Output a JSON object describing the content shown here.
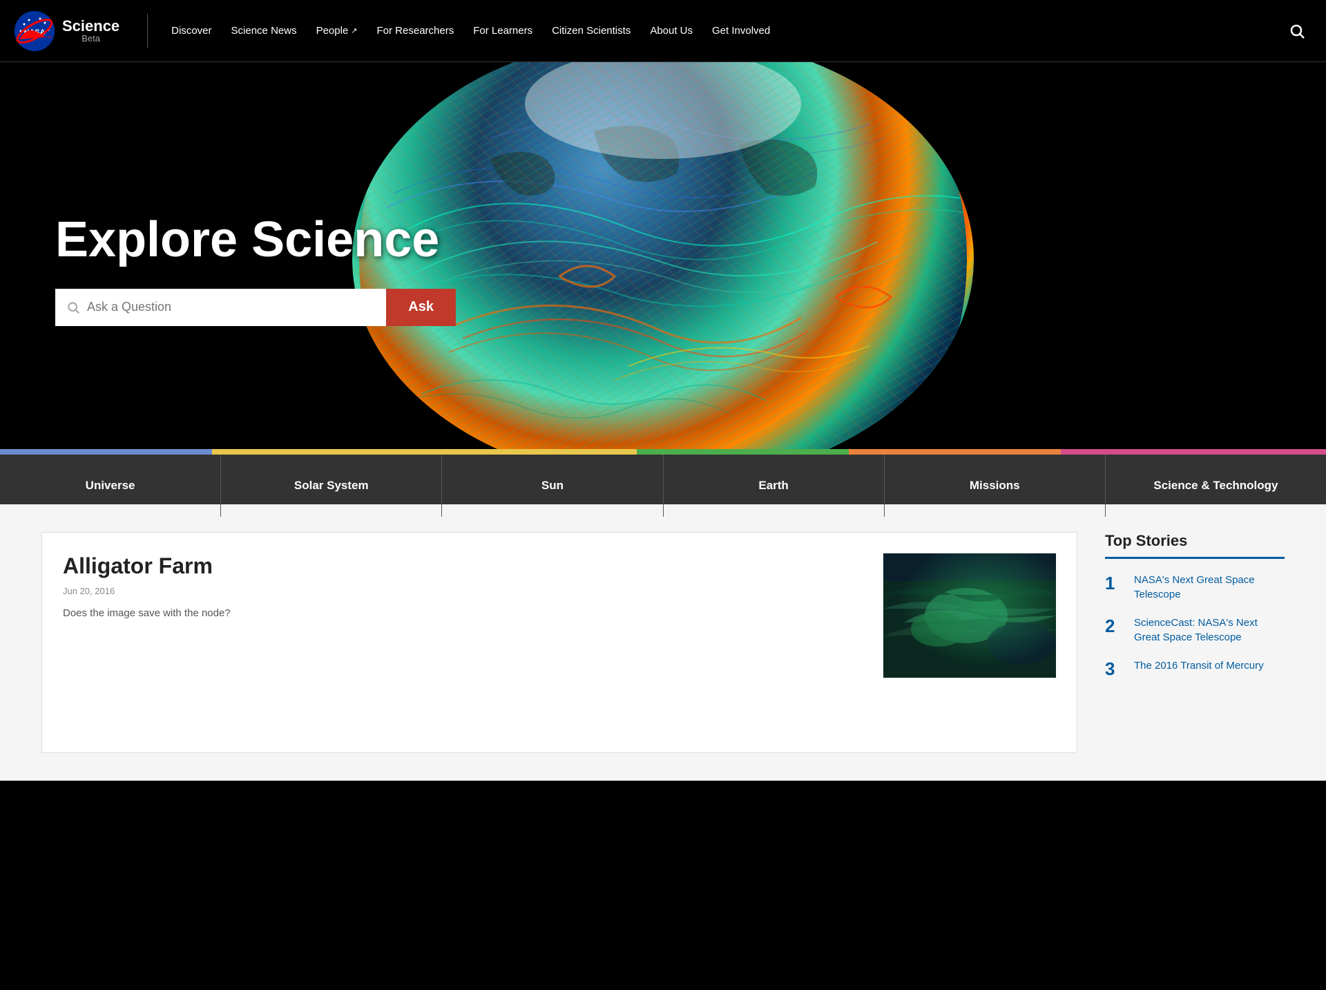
{
  "header": {
    "logo_science": "Science",
    "logo_beta": "Beta",
    "nav_items": [
      {
        "label": "Discover",
        "external": false
      },
      {
        "label": "Science News",
        "external": false
      },
      {
        "label": "People",
        "external": true
      },
      {
        "label": "For Researchers",
        "external": false
      },
      {
        "label": "For Learners",
        "external": false
      },
      {
        "label": "Citizen Scientists",
        "external": false
      },
      {
        "label": "About Us",
        "external": false
      },
      {
        "label": "Get Involved",
        "external": false
      }
    ]
  },
  "hero": {
    "title": "Explore Science",
    "search_placeholder": "Ask a Question",
    "ask_button": "Ask"
  },
  "category_nav": {
    "items": [
      {
        "label": "Universe"
      },
      {
        "label": "Solar System"
      },
      {
        "label": "Sun"
      },
      {
        "label": "Earth"
      },
      {
        "label": "Missions"
      },
      {
        "label": "Science & Technology"
      }
    ]
  },
  "color_bar": {
    "segments": [
      {
        "color": "#6b8cce",
        "width": "16%"
      },
      {
        "color": "#e8c84c",
        "width": "16%"
      },
      {
        "color": "#e8c84c",
        "width": "16%"
      },
      {
        "color": "#4cae4c",
        "width": "16%"
      },
      {
        "color": "#e8823c",
        "width": "16%"
      },
      {
        "color": "#d44c8c",
        "width": "20%"
      }
    ]
  },
  "main_article": {
    "title": "Alligator Farm",
    "date": "Jun 20, 2016",
    "description": "Does the image save with the node?",
    "image_alt": "Satellite image of alligator farm"
  },
  "top_stories": {
    "title": "Top Stories",
    "items": [
      {
        "num": "1",
        "label": "NASA's Next Great Space Telescope"
      },
      {
        "num": "2",
        "label": "ScienceCast: NASA's Next Great Space Telescope"
      },
      {
        "num": "3",
        "label": "The 2016 Transit of Mercury"
      }
    ]
  }
}
